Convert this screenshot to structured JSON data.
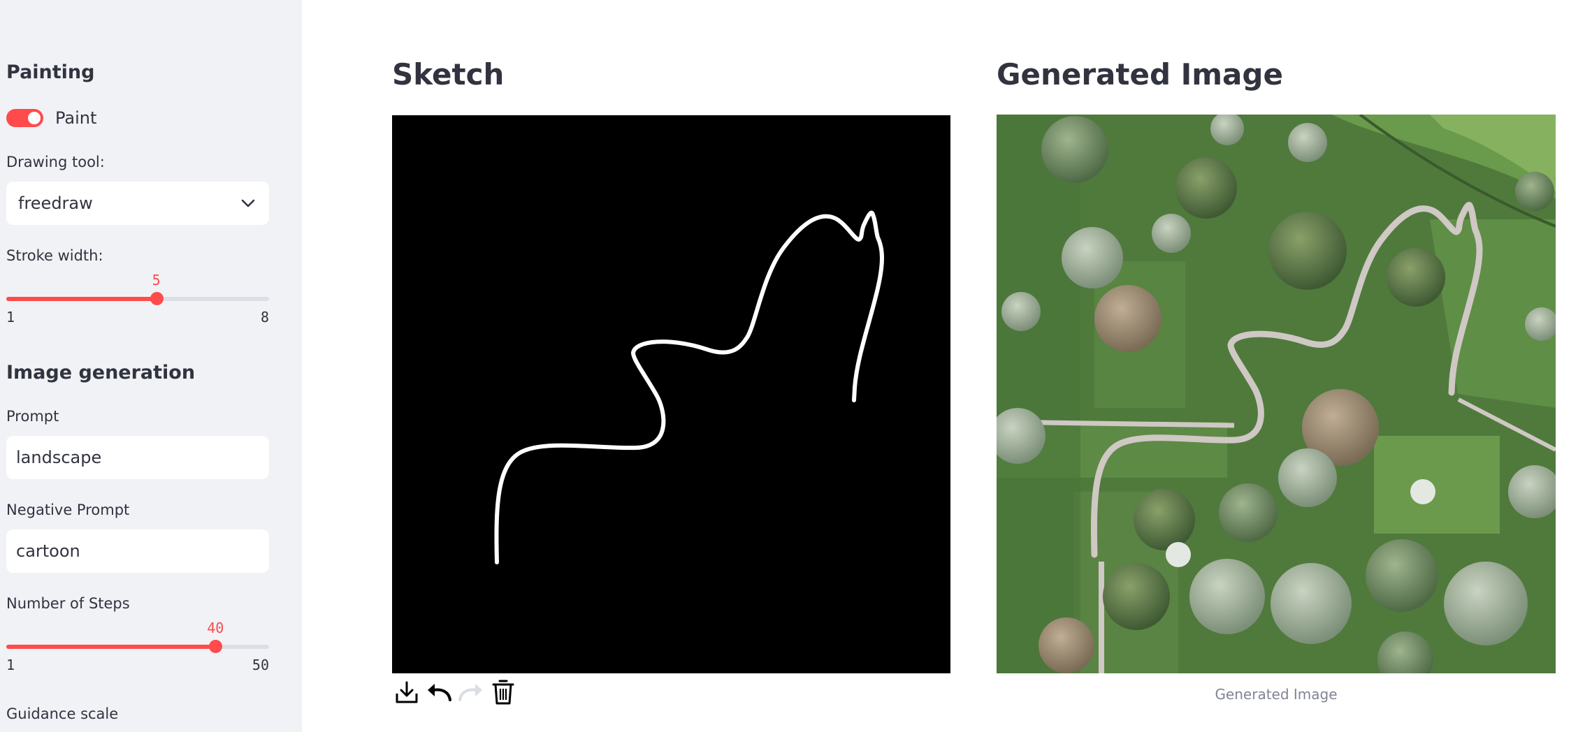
{
  "sidebar": {
    "painting_title": "Painting",
    "paint_toggle_label": "Paint",
    "drawing_tool_label": "Drawing tool:",
    "drawing_tool_value": "freedraw",
    "stroke_width": {
      "label": "Stroke width:",
      "value": "5",
      "min": "1",
      "max": "8",
      "fraction": 0.571
    },
    "image_generation_title": "Image generation",
    "prompt_label": "Prompt",
    "prompt_value": "landscape",
    "negative_prompt_label": "Negative Prompt",
    "negative_prompt_value": "cartoon",
    "steps": {
      "label": "Number of Steps",
      "value": "40",
      "min": "1",
      "max": "50",
      "fraction": 0.796
    },
    "guidance_label": "Guidance scale"
  },
  "main": {
    "sketch_title": "Sketch",
    "generated_title": "Generated Image",
    "generated_caption": "Generated Image"
  },
  "colors": {
    "accent": "#ff4b4b",
    "sidebar_bg": "#f0f2f6",
    "text": "#31333f"
  },
  "icons": [
    "chevron-down-icon",
    "download-icon",
    "undo-icon",
    "redo-icon",
    "trash-icon"
  ]
}
